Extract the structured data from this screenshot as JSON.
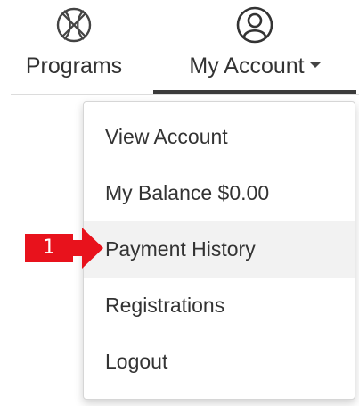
{
  "nav": {
    "items": [
      {
        "label": "Programs",
        "icon": "basketball-icon"
      },
      {
        "label": "My Account",
        "icon": "user-avatar-icon"
      }
    ]
  },
  "dropdown": {
    "items": [
      {
        "label": "View Account"
      },
      {
        "label": "My Balance $0.00"
      },
      {
        "label": "Payment History"
      },
      {
        "label": "Registrations"
      },
      {
        "label": "Logout"
      }
    ]
  },
  "annotation": {
    "step": "1"
  },
  "colors": {
    "annotation": "#e8121c",
    "active_bar": "#3a3a3a",
    "highlight_bg": "#f2f2f2"
  }
}
